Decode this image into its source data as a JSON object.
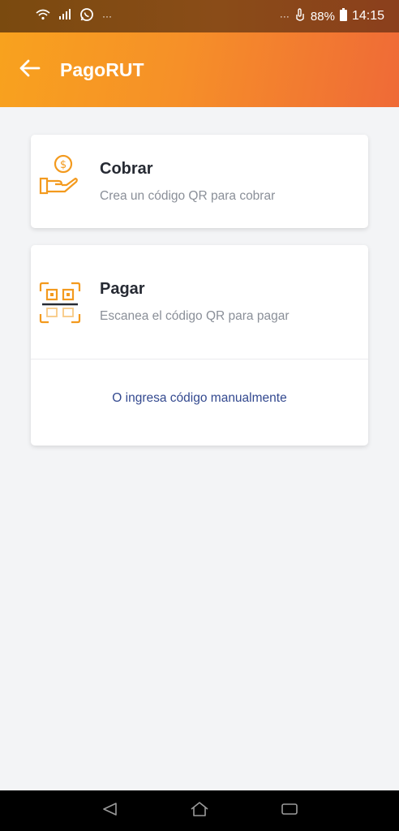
{
  "status_bar": {
    "dots": "···",
    "battery_percent": "88%",
    "time": "14:15",
    "icons": [
      "wifi-icon",
      "signal-icon",
      "whatsapp-icon",
      "touch-icon",
      "battery-icon"
    ]
  },
  "app_bar": {
    "title": "PagoRUT",
    "back_icon": "arrow-left-icon"
  },
  "options": {
    "cobrar": {
      "title": "Cobrar",
      "subtitle": "Crea un código QR para cobrar",
      "icon": "hand-coin-icon"
    },
    "pagar": {
      "title": "Pagar",
      "subtitle": "Escanea el código QR para pagar",
      "icon": "qr-scan-icon"
    },
    "manual_link": "O ingresa código manualmente"
  },
  "nav_bar": {
    "icons": [
      "back-triangle-icon",
      "home-icon",
      "recents-icon"
    ]
  },
  "colors": {
    "accent": "#f6921e",
    "link": "#33498f",
    "icon_orange": "#f39a1e"
  }
}
